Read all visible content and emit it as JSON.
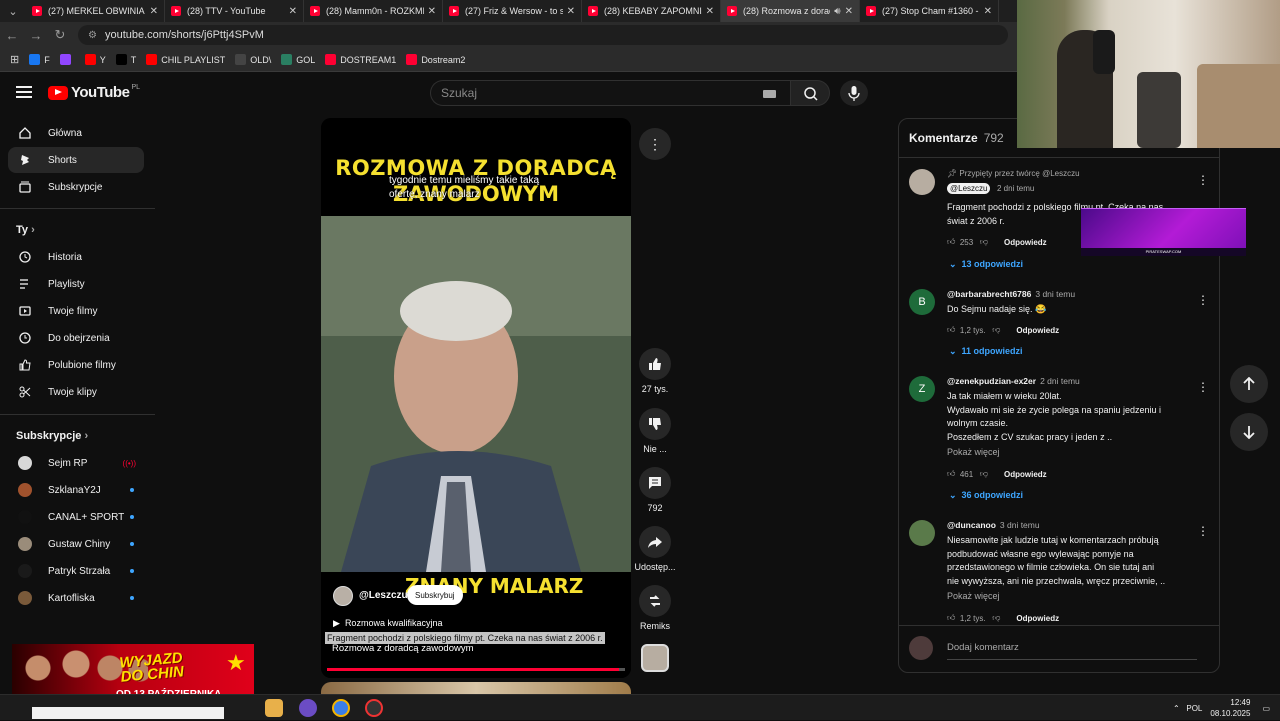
{
  "browser": {
    "tabs": [
      {
        "title": "(27) MERKEL OBWINIA POLSKĘ",
        "active": false
      },
      {
        "title": "(28) TTV - YouTube",
        "active": false
      },
      {
        "title": "(28) Mamm0n - ROZKMINA",
        "active": false
      },
      {
        "title": "(27) Friz & Wersow - to się",
        "active": false
      },
      {
        "title": "(28) KEBABY ZAPOMNIANE",
        "active": false
      },
      {
        "title": "(28) Rozmowa z doradcą",
        "active": true
      },
      {
        "title": "(27) Stop Cham #1360 - N",
        "active": false
      }
    ],
    "url": "youtube.com/shorts/j6Pttj4SPvM",
    "bookmarks": [
      {
        "label": "F",
        "color": "#1877f2"
      },
      {
        "label": "",
        "color": "#9146ff"
      },
      {
        "label": "Y",
        "color": "#ff0000"
      },
      {
        "label": "T",
        "color": "#000000"
      },
      {
        "label": "CHIL PLAYLIST",
        "color": "#ff0000"
      },
      {
        "label": "OLD\\",
        "color": "#444444"
      },
      {
        "label": "GOL",
        "color": "#2a7f62"
      },
      {
        "label": "DOSTREAM1",
        "color": "#ff0033"
      },
      {
        "label": "Dostream2",
        "color": "#ff0033"
      }
    ]
  },
  "yt": {
    "logo_text": "YouTube",
    "country": "PL",
    "search_placeholder": "Szukaj"
  },
  "sidebar": {
    "main": [
      {
        "label": "Główna",
        "icon": "home-icon"
      },
      {
        "label": "Shorts",
        "icon": "shorts-icon",
        "active": true
      },
      {
        "label": "Subskrypcje",
        "icon": "subscriptions-icon"
      }
    ],
    "you_heading": "Ty",
    "you": [
      {
        "label": "Historia",
        "icon": "history-icon"
      },
      {
        "label": "Playlisty",
        "icon": "playlists-icon"
      },
      {
        "label": "Twoje filmy",
        "icon": "your-videos-icon"
      },
      {
        "label": "Do obejrzenia",
        "icon": "watch-later-icon"
      },
      {
        "label": "Polubione filmy",
        "icon": "liked-icon"
      },
      {
        "label": "Twoje klipy",
        "icon": "clips-icon"
      }
    ],
    "subs_heading": "Subskrypcje",
    "subs": [
      {
        "label": "Sejm RP",
        "color": "#d8d8d8",
        "live": true
      },
      {
        "label": "SzklanaY2J",
        "color": "#a0522d"
      },
      {
        "label": "CANAL+ SPORT",
        "color": "#111111"
      },
      {
        "label": "Gustaw Chiny",
        "color": "#9a8c7a"
      },
      {
        "label": "Patryk Strzała",
        "color": "#1a1a1a"
      },
      {
        "label": "Kartofliska",
        "color": "#7a5a3a"
      }
    ]
  },
  "short": {
    "title_line1": "ROZMOWA Z DORADCĄ",
    "title_line2": "ZAWODOWYM",
    "subtitle_overlay": "tygodnie temu mieliśmy takie taką ofertę, znany malarz",
    "bottom_overlay": "ZNANY MALARZ",
    "channel": "@Leszczu",
    "subscribe_label": "Subskrybuj",
    "playlist": "Rozmowa kwalifikacyjna",
    "caption": "Fragment pochodzi z polskiego filmy pt. Czeka na nas  świat z 2006 r.",
    "video_title": "Rozmowa z doradcą zawodowym",
    "progress": 0.98
  },
  "actions": {
    "likes": "27 tys.",
    "dislike": "Nie ...",
    "comments": "792",
    "share": "Udostęp...",
    "remix": "Remiks"
  },
  "comments": {
    "header": "Komentarze",
    "count": "792",
    "pinned_by": "Przypięty przez twórcę @Leszczu",
    "items": [
      {
        "author": "@Leszczu",
        "time": "2 dni temu",
        "lines": [
          "Fragment pochodzi z polskiego filmu pt. Czeka na nas",
          "świat z 2006 r."
        ],
        "likes": "253",
        "reply_label": "Odpowiedz",
        "replies": "13 odpowiedzi",
        "avatar_color": "#b7ada1",
        "avatar_letter": ""
      },
      {
        "author": "@barbarabrecht6786",
        "time": "3 dni temu",
        "lines": [
          "Do Sejmu nadaje się. 😂"
        ],
        "likes": "1,2 tys.",
        "reply_label": "Odpowiedz",
        "replies": "11 odpowiedzi",
        "avatar_color": "#1e6b3a",
        "avatar_letter": "B"
      },
      {
        "author": "@zenekpudzian-ex2er",
        "time": "2 dni temu",
        "lines": [
          "Ja tak miałem w wieku 20lat.",
          "Wydawało mi sie że zycie polega na spaniu jedzeniu i",
          "wolnym czasie.",
          "Poszedłem z CV szukac pracy i jeden z .."
        ],
        "more": "Pokaż więcej",
        "likes": "461",
        "reply_label": "Odpowiedz",
        "replies": "36 odpowiedzi",
        "avatar_color": "#1e6b3a",
        "avatar_letter": "Z"
      },
      {
        "author": "@duncanoo",
        "time": "3 dni temu",
        "lines": [
          "Niesamowite jak ludzie tutaj w komentarzach próbują",
          "podbudować własne ego wylewając pomyje na",
          "przedstawionego w filmie człowieka. On sie tutaj ani",
          "nie wywyższa, ani nie przechwala, wręcz przeciwnie, .."
        ],
        "more": "Pokaż więcej",
        "likes": "1,2 tys.",
        "reply_label": "Odpowiedz",
        "avatar_color": "#5a7a4a",
        "avatar_letter": ""
      }
    ],
    "add_placeholder": "Dodaj komentarz"
  },
  "ad": {
    "label": "PIRATESWAP.COM"
  },
  "banner": {
    "line1": "WYJAZD",
    "line2": "DO CHIN",
    "date": "OD 13 PAŹDZIERNIKA"
  },
  "taskbar": {
    "lang": "POL",
    "time": "12:49",
    "date": "08.10.2025"
  }
}
